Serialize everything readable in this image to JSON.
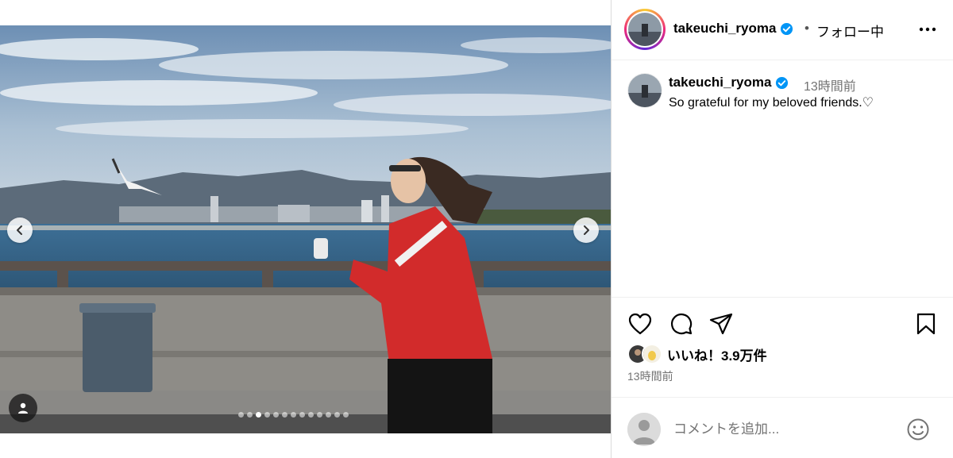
{
  "post": {
    "username": "takeuchi_ryoma",
    "separator": "•",
    "follow_status": "フォロー中",
    "caption_username": "takeuchi_ryoma",
    "caption_time": "13時間前",
    "caption_text": "So grateful for my beloved friends.♡",
    "likes_text": "いいね！3.9万件",
    "posted_ago": "13時間前",
    "comment_placeholder": "コメントを追加...",
    "carousel": {
      "total_slides": 13,
      "current_index": 2
    }
  },
  "icons": {
    "verified": "verified-badge-icon",
    "more": "more-horizontal-icon",
    "like": "heart-icon",
    "comment": "comment-bubble-icon",
    "share": "paper-plane-icon",
    "save": "bookmark-icon",
    "tag": "user-tag-icon",
    "prev": "chevron-left-icon",
    "next": "chevron-right-icon",
    "emoji": "emoji-smiley-icon"
  },
  "colors": {
    "verified_blue": "#0095f6",
    "secondary_text": "#737373",
    "divider": "#efefef"
  }
}
